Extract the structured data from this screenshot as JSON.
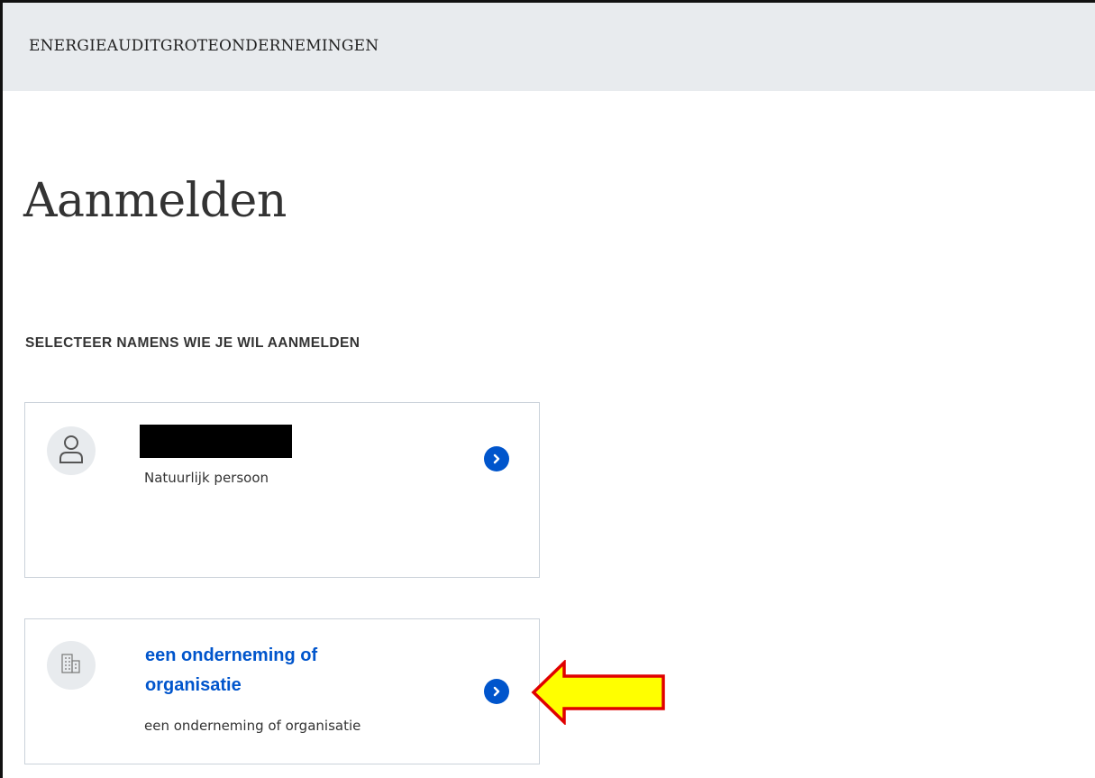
{
  "header": {
    "title": "ENERGIEAUDITGROTEONDERNEMINGEN"
  },
  "page": {
    "title": "Aanmelden"
  },
  "section": {
    "label": "SELECTEER NAMENS WIE JE WIL AANMELDEN"
  },
  "options": [
    {
      "name": "",
      "subtitle": "Natuurlijk persoon",
      "icon": "person-icon"
    },
    {
      "name": "een onderneming of organisatie",
      "subtitle": "een onderneming of organisatie",
      "icon": "building-icon"
    }
  ],
  "colors": {
    "accent": "#0055cc",
    "header_bg": "#e8ebee",
    "annotation_fill": "#ffff00",
    "annotation_stroke": "#e00000"
  }
}
